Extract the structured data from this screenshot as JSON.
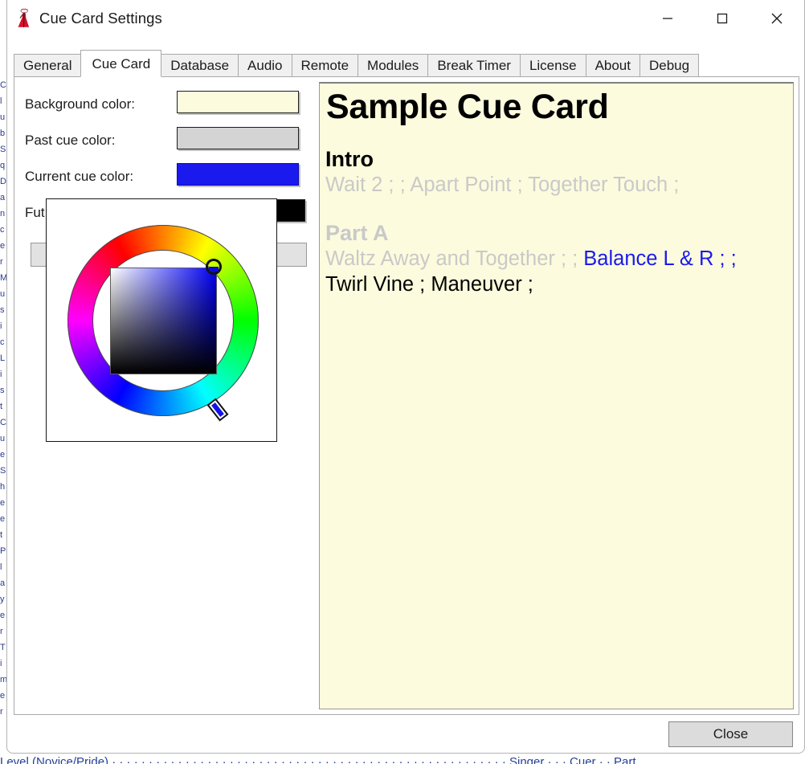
{
  "window": {
    "title": "Cue Card Settings",
    "icon": "dancer-icon",
    "controls": {
      "minimize": "—",
      "maximize": "□",
      "close": "✕"
    }
  },
  "tabs": [
    {
      "label": "General",
      "active": false
    },
    {
      "label": "Cue Card",
      "active": true
    },
    {
      "label": "Database",
      "active": false
    },
    {
      "label": "Audio",
      "active": false
    },
    {
      "label": "Remote",
      "active": false
    },
    {
      "label": "Modules",
      "active": false
    },
    {
      "label": "Break Timer",
      "active": false
    },
    {
      "label": "License",
      "active": false
    },
    {
      "label": "About",
      "active": false
    },
    {
      "label": "Debug",
      "active": false
    }
  ],
  "settings": {
    "rows": [
      {
        "label": "Background color:",
        "color": "#FCFBDD"
      },
      {
        "label": "Past cue color:",
        "color": "#D4D4D4"
      },
      {
        "label": "Current cue color:",
        "color": "#1A1AEE"
      },
      {
        "label": "Future cue color:",
        "label_clipped": "Fut",
        "color": "#000000"
      }
    ],
    "left_button": "",
    "right_button": ""
  },
  "color_picker": {
    "name": "color-wheel-picker",
    "selected_color": "#1A1AEE",
    "hue_degrees": 240,
    "saturation": 100,
    "value": 93
  },
  "cue_card": {
    "title": "Sample Cue Card",
    "sections": [
      {
        "heading": "Intro",
        "heading_state": "future",
        "lines": [
          {
            "segments": [
              {
                "text": "Wait 2 ; ; Apart Point ; Together Touch ;",
                "state": "past"
              }
            ]
          }
        ]
      },
      {
        "heading": "Part A",
        "heading_state": "past",
        "lines": [
          {
            "segments": [
              {
                "text": "Waltz Away and Together ; ; ",
                "state": "past"
              },
              {
                "text": "Balance L & R ; ;",
                "state": "current"
              }
            ]
          },
          {
            "segments": [
              {
                "text": "Twirl Vine ; Maneuver ;",
                "state": "future"
              }
            ]
          }
        ]
      }
    ]
  },
  "footer": {
    "close_label": "Close"
  },
  "background_window": {
    "bottom_strip": "Level (Novice/Pride) · · · · · · · · · · · · · · · · · · · · · · · · · · · · · · · · · · · · · · · · · · · · · · · · · · · · · · Singer · · · Cuer · · Part",
    "left_edge": "·"
  },
  "colors": {
    "cue_card_bg": "#FCFBDD",
    "past_cue": "#C9C9C9",
    "current_cue": "#1A1AEE",
    "future_cue": "#000000",
    "tab_inactive_bg": "#F0F0F0",
    "tab_border": "#A9A9A9",
    "button_face": "#DCDCDC",
    "accent_icon": "#D8102B"
  }
}
